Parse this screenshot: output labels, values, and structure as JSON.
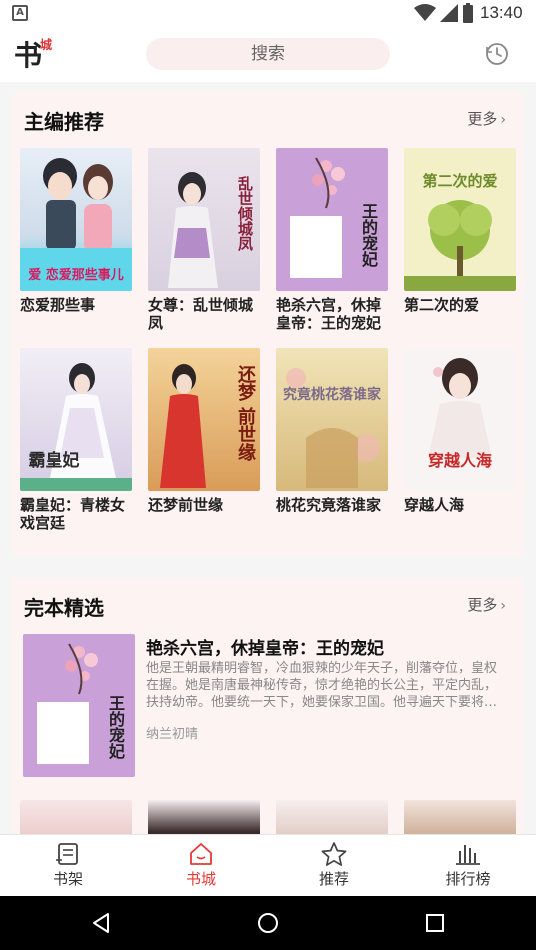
{
  "status_bar": {
    "notification_icon": "A",
    "time": "13:40"
  },
  "header": {
    "logo_main": "书",
    "logo_sub": "城",
    "search_placeholder": "搜索"
  },
  "section_editor": {
    "title": "主编推荐",
    "more": "更多",
    "books": [
      {
        "title": "恋爱那些事",
        "cover_text": "爱 恋爱那些事儿",
        "cover_color": "#d8e4f0"
      },
      {
        "title": "女尊：乱世倾城凤",
        "cover_text": "乱世倾城凤",
        "cover_color": "#ece4ea"
      },
      {
        "title": "艳杀六宫，休掉皇帝：王的宠妃",
        "cover_text": "王的宠妃",
        "cover_color": "#c9a0d8"
      },
      {
        "title": "第二次的爱",
        "cover_text": "第二次的爱",
        "cover_color": "#f3f0c8"
      },
      {
        "title": "霸皇妃：青楼女戏宫廷",
        "cover_text": "霸皇妃",
        "cover_color": "#e6e0ee"
      },
      {
        "title": "还梦前世缘",
        "cover_text": "还梦 前世缘",
        "cover_color": "#e9c48a"
      },
      {
        "title": "桃花究竟落谁家",
        "cover_text": "究竟桃花落谁家",
        "cover_color": "#ead9a8"
      },
      {
        "title": "穿越人海",
        "cover_text": "穿越人海",
        "cover_color": "#f4eeee"
      }
    ]
  },
  "section_complete": {
    "title": "完本精选",
    "more": "更多",
    "featured": {
      "title": "艳杀六宫，休掉皇帝：王的宠妃",
      "description": "他是王朝最精明睿智，冷血狠辣的少年天子，削藩夺位，皇权在握。她是南唐最神秘传奇，惊才绝艳的长公主，平定内乱，扶持幼帝。他要统一天下，她要保家卫国。他寻遍天下要将…",
      "author": "纳兰初晴",
      "cover_text": "王的宠妃"
    },
    "peek_colors": [
      "#f3dede",
      "#f0e6ea",
      "#f4ecea",
      "#efe0d8"
    ]
  },
  "tabbar": {
    "tabs": [
      {
        "label": "书架",
        "icon": "bookshelf-icon"
      },
      {
        "label": "书城",
        "icon": "home-icon"
      },
      {
        "label": "推荐",
        "icon": "star-icon"
      },
      {
        "label": "排行榜",
        "icon": "chart-icon"
      }
    ],
    "active_color": "#e53935"
  },
  "system_nav": {
    "buttons": [
      "back-icon",
      "home-circle-icon",
      "recents-icon"
    ]
  }
}
